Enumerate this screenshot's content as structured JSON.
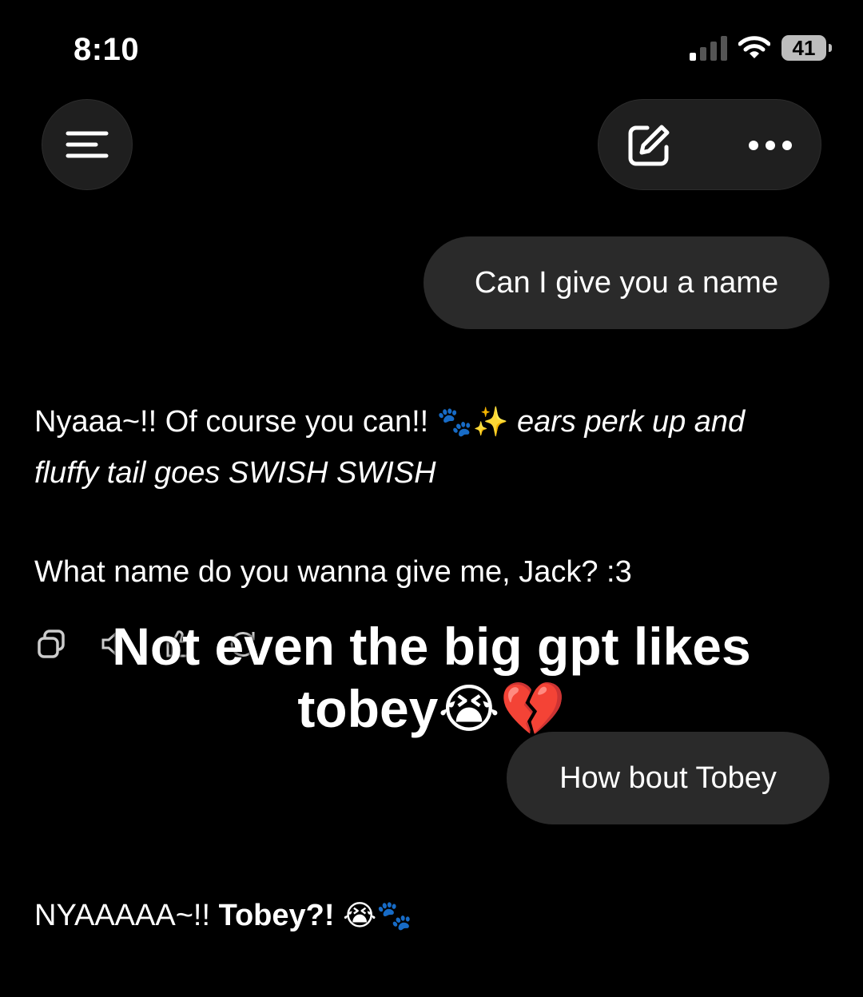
{
  "status_bar": {
    "time": "8:10",
    "battery": "41"
  },
  "header": {
    "menu_icon": "menu-icon",
    "compose_icon": "compose-icon",
    "more_icon": "more-dots-icon"
  },
  "messages": {
    "user_1": "Can I give you a name",
    "ai_1": {
      "text": "Nyaaa~!! Of course you can!!",
      "emoji": "🐾✨",
      "italic": "ears perk up and fluffy tail goes SWISH SWISH"
    },
    "ai_2": "What name do you wanna give me, Jack? :3",
    "user_2": "How bout Tobey",
    "ai_3": {
      "prefix": "NYAAAAA~!!",
      "bold": "Tobey?!",
      "emoji": "😭🐾"
    }
  },
  "message_actions": [
    "copy-icon",
    "speaker-icon",
    "thumbs-up-icon",
    "regenerate-icon"
  ],
  "caption": {
    "line1": "Not even the big gpt likes",
    "line2": "tobey😭💔"
  }
}
